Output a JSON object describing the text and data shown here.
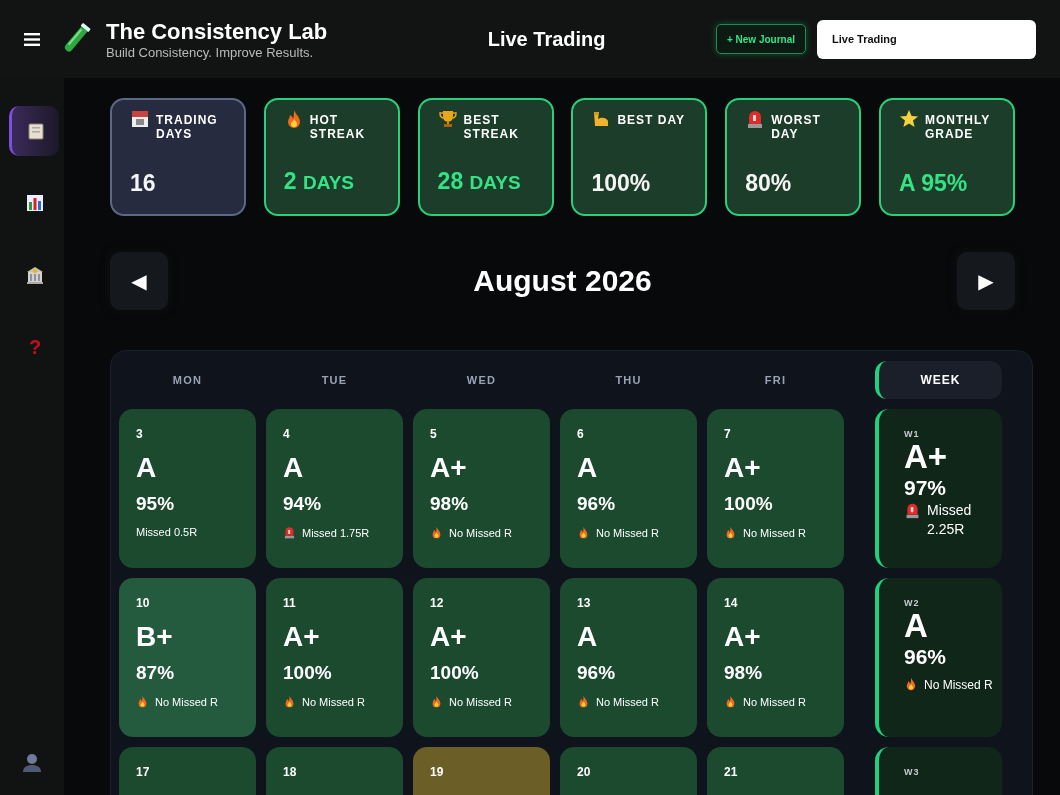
{
  "header": {
    "title": "The Consistency Lab",
    "subtitle": "Build Consistency. Improve Results.",
    "page_title": "Live Trading",
    "new_button": "+ New Journal",
    "account_select": {
      "value": "Live Trading"
    }
  },
  "sidebar": {
    "items": [
      {
        "kind": "clipboard",
        "selected": true
      },
      {
        "kind": "chart",
        "selected": false
      },
      {
        "kind": "bank",
        "selected": false
      },
      {
        "kind": "help",
        "glyph": "?",
        "selected": false
      }
    ]
  },
  "stats": [
    {
      "kind": "neutral",
      "label": "TRADING DAYS",
      "value": "16",
      "highlight": false
    },
    {
      "kind": "success",
      "label": "HOT STREAK",
      "value": "2",
      "unit": "DAYS",
      "highlight": true
    },
    {
      "kind": "success",
      "label": "BEST STREAK",
      "value": "28",
      "unit": "DAYS",
      "highlight": true
    },
    {
      "kind": "success",
      "label": "BEST DAY",
      "value": "100%",
      "highlight": false
    },
    {
      "kind": "success",
      "label": "WORST DAY",
      "value": "80%",
      "highlight": false
    },
    {
      "kind": "success",
      "label": "MONTHLY GRADE",
      "value": "A 95%",
      "highlight": true
    }
  ],
  "month_nav": {
    "prev": "◀",
    "title": "August 2026",
    "next": "▶"
  },
  "calendar": {
    "weekdays": [
      "MON",
      "TUE",
      "WED",
      "THU",
      "FRI"
    ],
    "week_header": "WEEK",
    "rows": [
      {
        "days": [
          {
            "date": "3",
            "grade": "A",
            "score": "95%",
            "note": {
              "kind": "plain",
              "text": "Missed 0.5R"
            },
            "color": "#1b4a2f"
          },
          {
            "date": "4",
            "grade": "A",
            "score": "94%",
            "note": {
              "kind": "missed",
              "text": "Missed 1.75R"
            },
            "color": "#1b4a2f"
          },
          {
            "date": "5",
            "grade": "A+",
            "score": "98%",
            "note": {
              "kind": "clean",
              "text": "No Missed R"
            },
            "color": "#1b4a2f"
          },
          {
            "date": "6",
            "grade": "A",
            "score": "96%",
            "note": {
              "kind": "clean",
              "text": "No Missed R"
            },
            "color": "#1b4a2f"
          },
          {
            "date": "7",
            "grade": "A+",
            "score": "100%",
            "note": {
              "kind": "clean",
              "text": "No Missed R"
            },
            "color": "#1b4a2f"
          }
        ],
        "week": {
          "label": "W1",
          "grade": "A+",
          "score": "97%",
          "note": {
            "kind": "missed",
            "text": "Missed 2.25R"
          }
        }
      },
      {
        "days": [
          {
            "date": "10",
            "grade": "B+",
            "score": "87%",
            "note": {
              "kind": "clean",
              "text": "No Missed R"
            },
            "color": "#245a3e"
          },
          {
            "date": "11",
            "grade": "A+",
            "score": "100%",
            "note": {
              "kind": "clean",
              "text": "No Missed R"
            },
            "color": "#1b4a2f"
          },
          {
            "date": "12",
            "grade": "A+",
            "score": "100%",
            "note": {
              "kind": "clean",
              "text": "No Missed R"
            },
            "color": "#1b4a2f"
          },
          {
            "date": "13",
            "grade": "A",
            "score": "96%",
            "note": {
              "kind": "clean",
              "text": "No Missed R"
            },
            "color": "#1b4a2f"
          },
          {
            "date": "14",
            "grade": "A+",
            "score": "98%",
            "note": {
              "kind": "clean",
              "text": "No Missed R"
            },
            "color": "#1b4a2f"
          }
        ],
        "week": {
          "label": "W2",
          "grade": "A",
          "score": "96%",
          "note": {
            "kind": "clean",
            "text": "No Missed R"
          }
        }
      },
      {
        "days": [
          {
            "date": "17",
            "color": "#1b4a2f"
          },
          {
            "date": "18",
            "color": "#1b4a2f"
          },
          {
            "date": "19",
            "color": "#6b5e26"
          },
          {
            "date": "20",
            "color": "#1b4a2f"
          },
          {
            "date": "21",
            "color": "#1b4a2f"
          }
        ],
        "week": {
          "label": "W3"
        }
      }
    ]
  }
}
